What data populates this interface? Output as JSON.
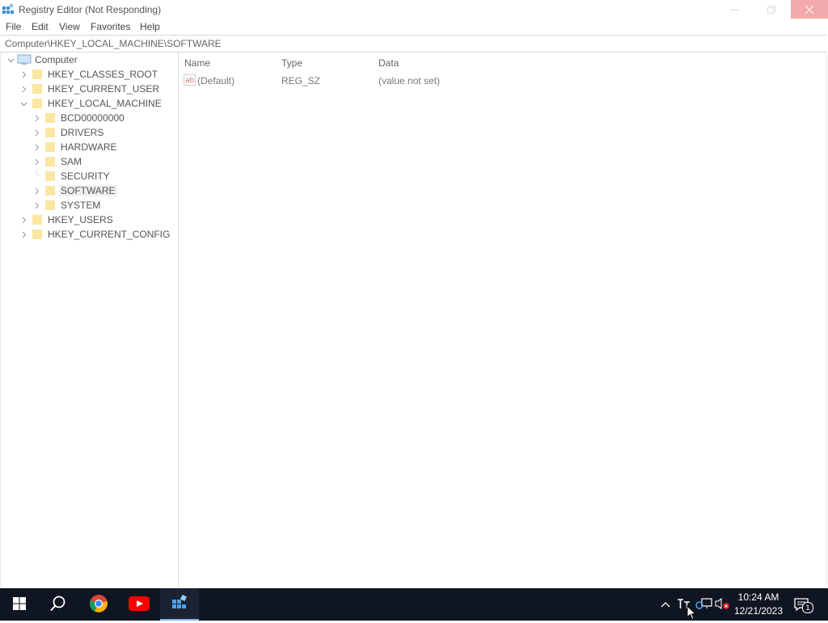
{
  "window": {
    "title": "Registry Editor (Not Responding)"
  },
  "menu": [
    "File",
    "Edit",
    "View",
    "Favorites",
    "Help"
  ],
  "address": "Computer\\HKEY_LOCAL_MACHINE\\SOFTWARE",
  "tree": {
    "root": "Computer",
    "hives": [
      "HKEY_CLASSES_ROOT",
      "HKEY_CURRENT_USER",
      "HKEY_LOCAL_MACHINE",
      "HKEY_USERS",
      "HKEY_CURRENT_CONFIG"
    ],
    "hklm_children": [
      "BCD00000000",
      "DRIVERS",
      "HARDWARE",
      "SAM",
      "SECURITY",
      "SOFTWARE",
      "SYSTEM"
    ],
    "selected": "SOFTWARE"
  },
  "list": {
    "columns": [
      "Name",
      "Type",
      "Data"
    ],
    "rows": [
      {
        "name": "(Default)",
        "type": "REG_SZ",
        "data": "(value not set)"
      }
    ]
  },
  "taskbar": {
    "apps": [
      "start-icon",
      "search-icon",
      "chrome-icon",
      "youtube-icon",
      "registry-editor-icon"
    ],
    "tray": {
      "time": "10:24 AM",
      "date": "12/21/2023",
      "notifications": "1"
    }
  },
  "colors": {
    "taskbar": "#101522",
    "close_hover": "#f1a9ab",
    "selection": "#f0f0f0",
    "folder": "#fbe7a1"
  }
}
